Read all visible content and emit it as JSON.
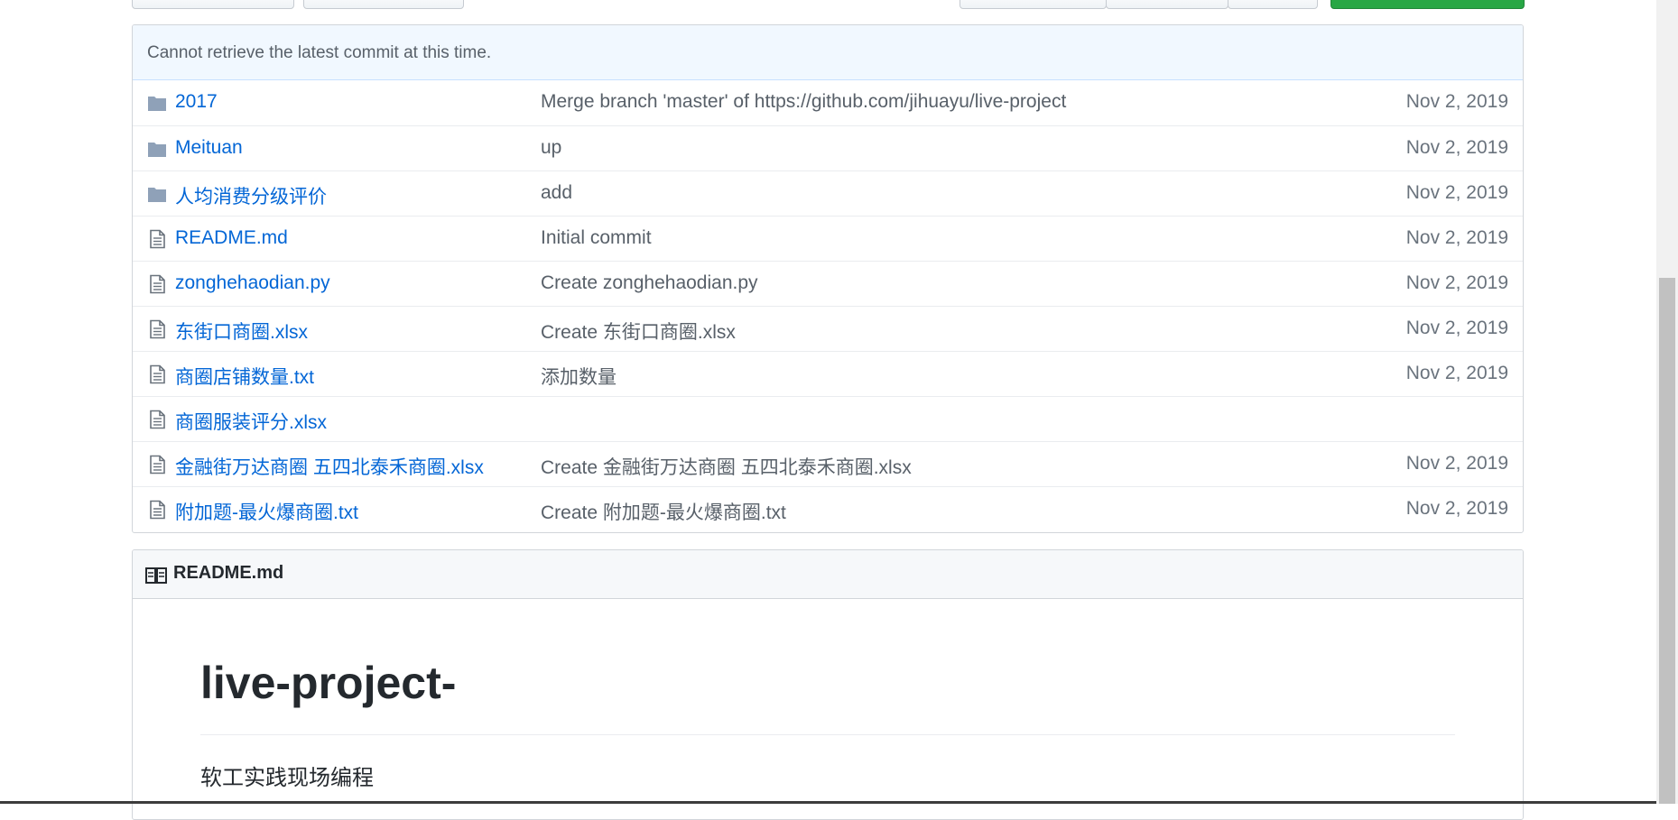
{
  "commit_bar": {
    "message": "Cannot retrieve the latest commit at this time."
  },
  "files": [
    {
      "type": "folder",
      "icon": "folder-icon",
      "name": "2017",
      "message": "Merge branch 'master' of https://github.com/jihuayu/live-project",
      "age": "Nov 2, 2019"
    },
    {
      "type": "folder",
      "icon": "folder-icon",
      "name": "Meituan",
      "message": "up",
      "age": "Nov 2, 2019"
    },
    {
      "type": "folder",
      "icon": "folder-icon",
      "name": "人均消费分级评价",
      "message": "add",
      "age": "Nov 2, 2019"
    },
    {
      "type": "file",
      "icon": "file-icon",
      "name": "README.md",
      "message": "Initial commit",
      "age": "Nov 2, 2019"
    },
    {
      "type": "file",
      "icon": "file-icon",
      "name": "zonghehaodian.py",
      "message": "Create zonghehaodian.py",
      "age": "Nov 2, 2019"
    },
    {
      "type": "file",
      "icon": "file-icon",
      "name": "东街口商圈.xlsx",
      "message": "Create 东街口商圈.xlsx",
      "age": "Nov 2, 2019"
    },
    {
      "type": "file",
      "icon": "file-icon",
      "name": "商圈店铺数量.txt",
      "message": "添加数量",
      "age": "Nov 2, 2019"
    },
    {
      "type": "file",
      "icon": "file-icon",
      "name": "商圈服装评分.xlsx",
      "message": "",
      "age": ""
    },
    {
      "type": "file",
      "icon": "file-icon",
      "name": "金融街万达商圈 五四北泰禾商圈.xlsx",
      "message": "Create 金融街万达商圈 五四北泰禾商圈.xlsx",
      "age": "Nov 2, 2019"
    },
    {
      "type": "file",
      "icon": "file-icon",
      "name": "附加题-最火爆商圈.txt",
      "message": "Create 附加题-最火爆商圈.txt",
      "age": "Nov 2, 2019"
    }
  ],
  "readme": {
    "header_icon": "book-icon",
    "header_title": "README.md",
    "heading": "live-project-",
    "paragraph": "软工实践现场编程"
  },
  "colors": {
    "link": "#0366d6",
    "folder_icon": "#79b8ff",
    "commit_bar_bg": "#f1f8ff",
    "primary_button": "#28a745"
  }
}
